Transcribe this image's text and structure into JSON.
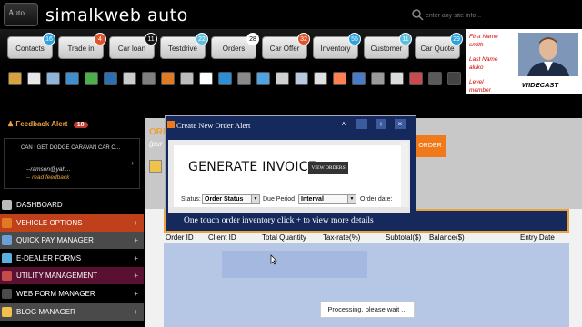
{
  "header": {
    "logo_text": "Auto",
    "brand": "simalkweb auto",
    "search_placeholder": "enter any site info..."
  },
  "nav": [
    {
      "label": "Contacts",
      "count": "16",
      "color": "#2aa3e0"
    },
    {
      "label": "Trade in",
      "count": "4",
      "color": "#e0522a"
    },
    {
      "label": "Car loan",
      "count": "11",
      "color": "#111111"
    },
    {
      "label": "Testdrive",
      "count": "22",
      "color": "#5bc0de"
    },
    {
      "label": "Orders",
      "count": "28",
      "color": "#ffffff"
    },
    {
      "label": "Car Offer",
      "count": "32",
      "color": "#e0522a"
    },
    {
      "label": "Inventory",
      "count": "55",
      "color": "#2aa3e0"
    },
    {
      "label": "Customer",
      "count": "11",
      "color": "#5bc0de"
    },
    {
      "label": "Car Quote",
      "count": "29",
      "color": "#2aa3e0"
    }
  ],
  "profile": {
    "first_name_label": "First Name",
    "first_name": "smith",
    "last_name_label": "Last Name",
    "last_name": "aluko",
    "level_label": "Level",
    "level": "member",
    "caption": "WIDECAST"
  },
  "feedback": {
    "title": "Feedback Alert",
    "count": "18",
    "message": "CAN I GET DODGE CARAVAN CAR O...",
    "author": "--ramson@yah...",
    "link": "-- read feedback"
  },
  "sidebar_menu": [
    {
      "label": "DASHBOARD",
      "bg": "#000000",
      "plus": ""
    },
    {
      "label": "VEHICLE OPTIONS",
      "bg": "#c1401c",
      "plus": "+"
    },
    {
      "label": "QUICK PAY MANAGER",
      "bg": "#4a4a4a",
      "plus": "+"
    },
    {
      "label": "E-DEALER FORMS",
      "bg": "#000000",
      "plus": "+"
    },
    {
      "label": "UTILITY MANAGEMENT",
      "bg": "#5a1030",
      "plus": "+"
    },
    {
      "label": "WEB FORM MANAGER",
      "bg": "#000000",
      "plus": "+"
    },
    {
      "label": "BLOG MANAGER",
      "bg": "#4a4a4a",
      "plus": "+"
    }
  ],
  "main": {
    "title": "ORD",
    "subtitle": "(pur",
    "order_button": "ORDER",
    "banner": "One touch order inventory click + to view more details",
    "columns": [
      "Order ID",
      "Client ID",
      "Total Quantity",
      "Tax-rate(%)",
      "Subtotal($)",
      "Balance($)",
      "Entry Date"
    ],
    "processing": "Processing, please wait ..."
  },
  "dialog": {
    "title": "Create New Order Alert",
    "heading": "GENERATE INVOICE",
    "view_orders": "VIEW ORDERS",
    "status_label": "Status:",
    "status_value": "Order Status",
    "due_label": "Due Period",
    "due_value": "Interval",
    "date_label": "Order date:"
  }
}
